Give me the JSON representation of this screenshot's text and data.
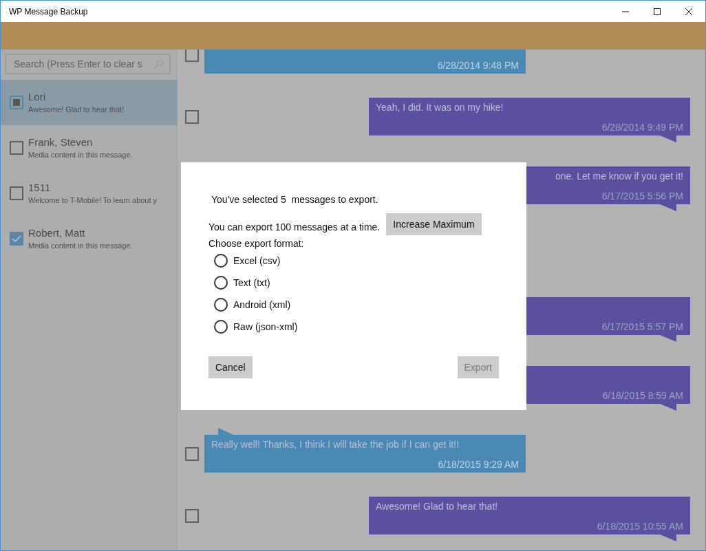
{
  "window": {
    "title": "WP Message Backup"
  },
  "search": {
    "placeholder": "Search (Press Enter to clear s"
  },
  "conversations": [
    {
      "name": "Lori",
      "preview": "Awesome! Glad to hear that!",
      "selected": true,
      "checked": false,
      "partial": true
    },
    {
      "name": "Frank, Steven",
      "preview": "Media content in this message.",
      "selected": false,
      "checked": false,
      "partial": false
    },
    {
      "name": "1511",
      "preview": "Welcome to T-Mobile! To learn about y",
      "selected": false,
      "checked": false,
      "partial": false
    },
    {
      "name": "Robert, Matt",
      "preview": "Media content in this message.",
      "selected": false,
      "checked": true,
      "partial": false
    }
  ],
  "messages": [
    {
      "kind": "incoming",
      "time": "6/28/2014 9:48 PM",
      "checked": false
    },
    {
      "kind": "outgoing",
      "text": "Yeah, I did. It was on my hike!",
      "time": "6/28/2014 9:49 PM",
      "checked": false
    },
    {
      "kind": "outgoing",
      "text": "one. Let me know if you get it!",
      "text_start_hidden": true,
      "time": "6/17/2015 5:56 PM"
    },
    {
      "kind": "outgoing",
      "time": "6/17/2015 5:57 PM"
    },
    {
      "kind": "outgoing",
      "time": "6/18/2015 8:59 AM"
    },
    {
      "kind": "incoming",
      "text": "Really well! Thanks, I think I will take the job if I can get it!!",
      "time": "6/18/2015 9:29 AM",
      "checked": false
    },
    {
      "kind": "outgoing",
      "text": "Awesome! Glad to hear that!",
      "time": "6/18/2015 10:55 AM",
      "checked": false
    }
  ],
  "dialog": {
    "selected_text": "You've selected 5  messages to export.",
    "limit_text": "You can export 100 messages at a time.",
    "increase_button": "Increase Maximum",
    "format_label": "Choose export format:",
    "formats": [
      {
        "label": "Excel (csv)",
        "selected": false
      },
      {
        "label": "Text (txt)",
        "selected": false
      },
      {
        "label": "Android (xml)",
        "selected": false
      },
      {
        "label": "Raw (json-xml)",
        "selected": false
      }
    ],
    "cancel_button": "Cancel",
    "export_button": {
      "label": "Export",
      "disabled": true
    }
  }
}
